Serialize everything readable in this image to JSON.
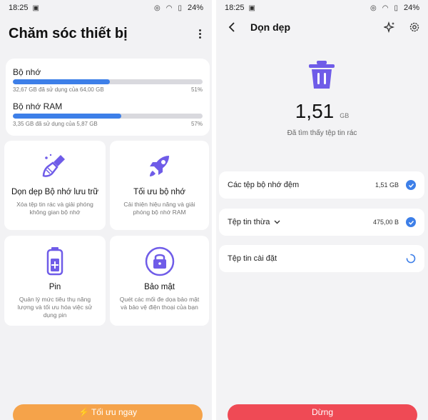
{
  "left": {
    "status": {
      "time": "18:25",
      "battery": "24%"
    },
    "title": "Chăm sóc thiết bị",
    "storage": {
      "label": "Bộ nhớ",
      "usage": "32,67 GB đã sử dụng của 64,00 GB",
      "percent": "51%",
      "fill": 0.51
    },
    "ram": {
      "label": "Bộ nhớ RAM",
      "usage": "3,35 GB đã sử dụng của 5,87 GB",
      "percent": "57%",
      "fill": 0.57
    },
    "tiles": [
      {
        "title": "Dọn dẹp Bộ nhớ lưu trữ",
        "desc": "Xóa tệp tin rác và giải phóng không gian bộ nhớ",
        "icon": "broom-icon"
      },
      {
        "title": "Tối ưu bộ nhớ",
        "desc": "Cải thiện hiệu năng và giải phóng bộ nhớ RAM",
        "icon": "rocket-icon"
      },
      {
        "title": "Pin",
        "desc": "Quản lý mức tiêu thụ năng lượng và tối ưu hóa việc sử dụng pin",
        "icon": "battery-icon"
      },
      {
        "title": "Bảo mật",
        "desc": "Quét các mối đe dọa bảo mật và bảo vệ điện thoại của bạn",
        "icon": "lock-icon"
      }
    ],
    "optimize_button": "Tối ưu ngay"
  },
  "right": {
    "status": {
      "time": "18:25",
      "battery": "24%"
    },
    "title": "Dọn dẹp",
    "junk": {
      "value": "1,51",
      "unit": "GB",
      "caption": "Đã tìm thấy tệp tin rác"
    },
    "rows": [
      {
        "label": "Các tệp bộ nhớ đệm",
        "size": "1,51 GB",
        "state": "checked"
      },
      {
        "label": "Tệp tin thừa",
        "size": "475,00 B",
        "state": "checked"
      },
      {
        "label": "Tệp tin cài đặt",
        "size": "",
        "state": "loading"
      }
    ],
    "stop_button": "Dừng"
  },
  "colors": {
    "accent_blue": "#3d7fe8",
    "icon_purple": "#6f5ce8",
    "optimize_orange": "#f5a34a",
    "stop_red": "#ef4a55"
  }
}
